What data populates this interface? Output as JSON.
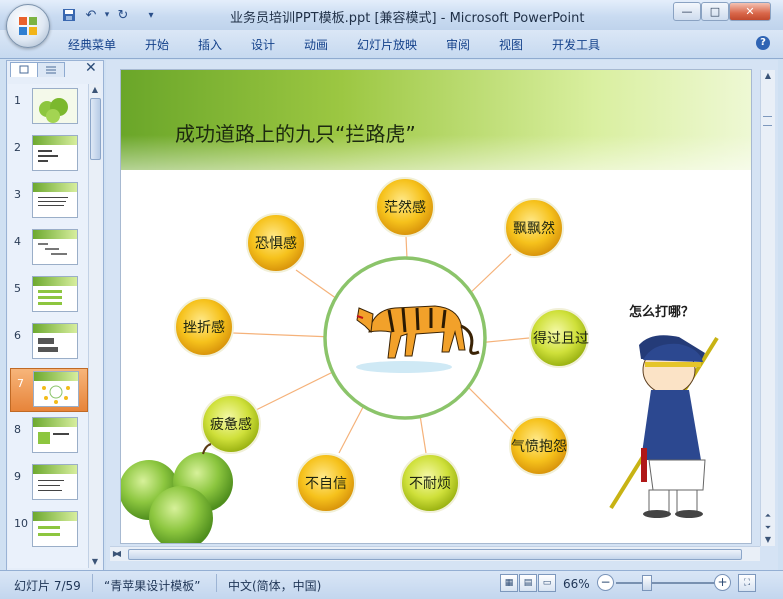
{
  "window": {
    "title": "业务员培训PPT模板.ppt [兼容模式] - Microsoft PowerPoint",
    "min_glyph": "—",
    "max_glyph": "□",
    "close_glyph": "✕"
  },
  "qat": {
    "save_icon": "save-icon",
    "undo_icon": "undo-icon",
    "redo_icon": "redo-icon",
    "more_icon": "customize-icon"
  },
  "ribbon": {
    "tabs": [
      "经典菜单",
      "开始",
      "插入",
      "设计",
      "动画",
      "幻灯片放映",
      "审阅",
      "视图",
      "开发工具"
    ],
    "help": "?"
  },
  "thumbnails": {
    "numbers": [
      "1",
      "2",
      "3",
      "4",
      "5",
      "6",
      "7",
      "8",
      "9",
      "10"
    ],
    "active_index": 7
  },
  "slide": {
    "title": "成功道路上的九只“拦路虎”",
    "center_image": "tiger",
    "factors": [
      "茫然感",
      "飘飘然",
      "得过且过",
      "气愤抱怨",
      "不耐烦",
      "不自信",
      "疲惫感",
      "挫折感",
      "恐惧感"
    ],
    "callout": "怎么打哪？",
    "decor": [
      "green-apples",
      "cartoon-warrior"
    ]
  },
  "status": {
    "slide_indicator": "幻灯片 7/59",
    "theme": "“青苹果设计模板”",
    "language": "中文(简体，中国)",
    "zoom": "66%",
    "zoom_level_percent": 66
  },
  "colors": {
    "accent": "#6aa629",
    "circle_gold": "#f2bb1a",
    "circle_lime": "#c7d82b",
    "ring": "#8bc46a",
    "arrow": "#f5b27a"
  }
}
